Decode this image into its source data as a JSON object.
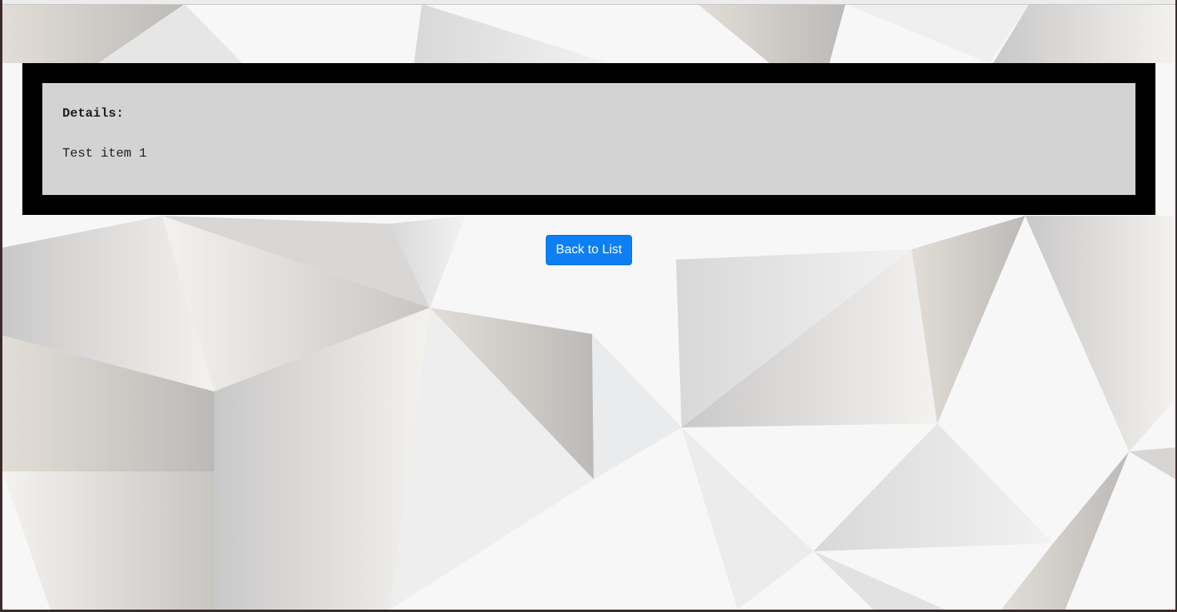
{
  "details": {
    "heading": "Details:",
    "text": "Test item 1"
  },
  "actions": {
    "back_label": "Back to List"
  },
  "colors": {
    "details_border": "#000000",
    "details_background": "#d3d3d3",
    "button_background": "#0d7ff5",
    "button_text": "#ffffff"
  }
}
